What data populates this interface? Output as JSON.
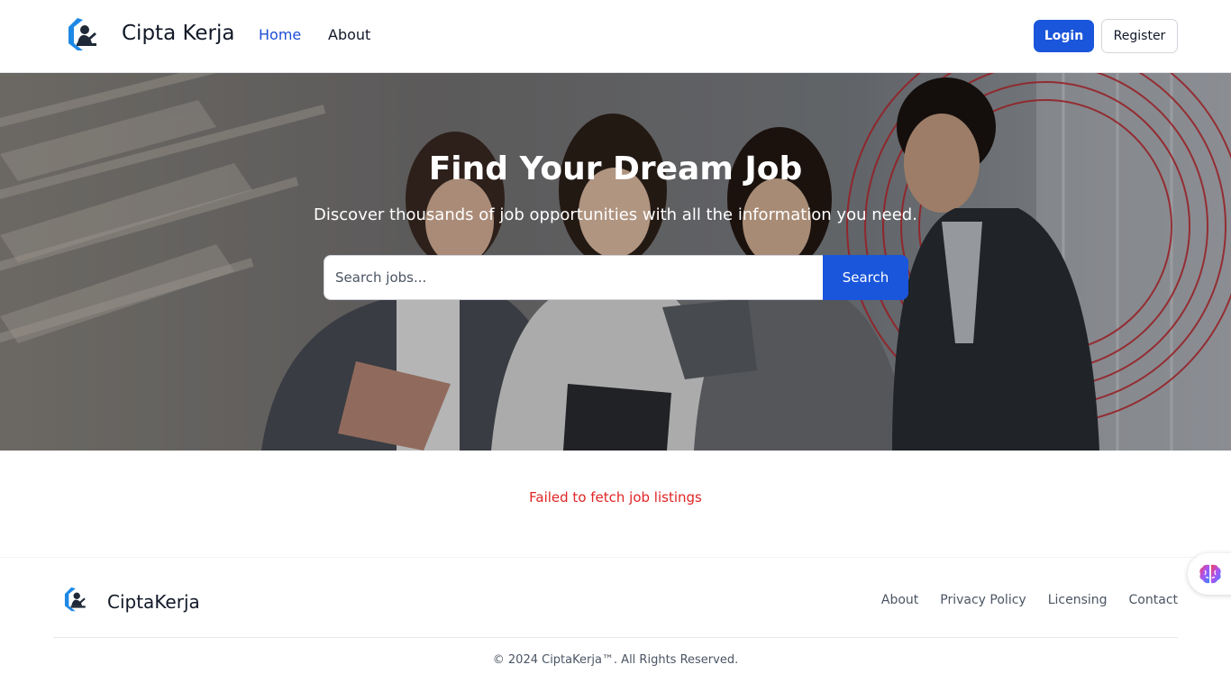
{
  "header": {
    "brand_name": "Cipta Kerja",
    "nav": [
      {
        "label": "Home"
      },
      {
        "label": "About"
      }
    ],
    "login_label": "Login",
    "register_label": "Register"
  },
  "hero": {
    "title": "Find Your Dream Job",
    "subtitle": "Discover thousands of job opportunities with all the information you need.",
    "search": {
      "placeholder": "Search jobs...",
      "value": "",
      "button_label": "Search"
    }
  },
  "status": {
    "error_message": "Failed to fetch job listings"
  },
  "footer": {
    "brand_name": "CiptaKerja",
    "links": [
      {
        "label": "About"
      },
      {
        "label": "Privacy Policy"
      },
      {
        "label": "Licensing"
      },
      {
        "label": "Contact"
      }
    ],
    "copyright": "© 2024 CiptaKerja™. All Rights Reserved."
  },
  "colors": {
    "primary": "#1a56db",
    "active_nav": "#1d4ed8",
    "error": "#e02424"
  },
  "icons": {
    "brand_logo": "briefcase-person-logo-icon",
    "floating_widget": "brain-icon"
  }
}
